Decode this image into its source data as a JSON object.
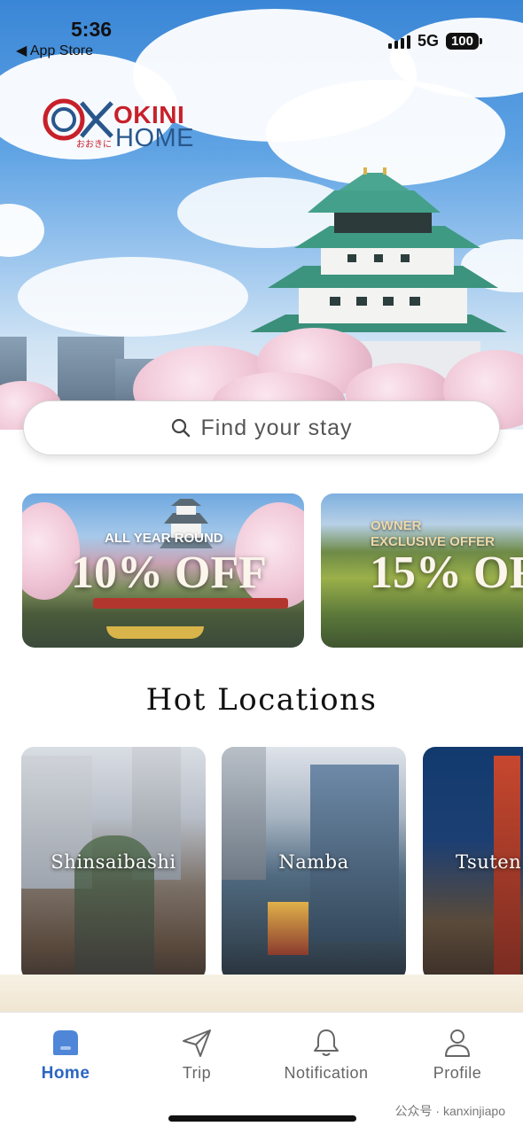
{
  "status_bar": {
    "time": "5:36",
    "back_label": "◀ App Store",
    "network": "5G",
    "battery": "100"
  },
  "logo": {
    "word1": "OKINI",
    "word2": "HOME",
    "jp": "おおきに"
  },
  "search": {
    "placeholder": "Find your stay"
  },
  "promos": [
    {
      "subtitle": "ALL YEAR ROUND",
      "headline": "10% OFF"
    },
    {
      "subtitle_line1": "OWNER",
      "subtitle_line2": "EXCLUSIVE OFFER",
      "headline": "15% OF"
    }
  ],
  "hot_locations": {
    "title": "Hot Locations",
    "items": [
      {
        "label": "Shinsaibashi"
      },
      {
        "label": "Namba"
      },
      {
        "label": "Tsuten"
      }
    ]
  },
  "tab_bar": {
    "items": [
      {
        "label": "Home",
        "icon": "home-icon",
        "active": true
      },
      {
        "label": "Trip",
        "icon": "paper-plane-icon"
      },
      {
        "label": "Notification",
        "icon": "bell-icon"
      },
      {
        "label": "Profile",
        "icon": "person-icon"
      }
    ],
    "accent": "#2b66c2"
  },
  "watermark": "公众号 · kanxinjiapo"
}
